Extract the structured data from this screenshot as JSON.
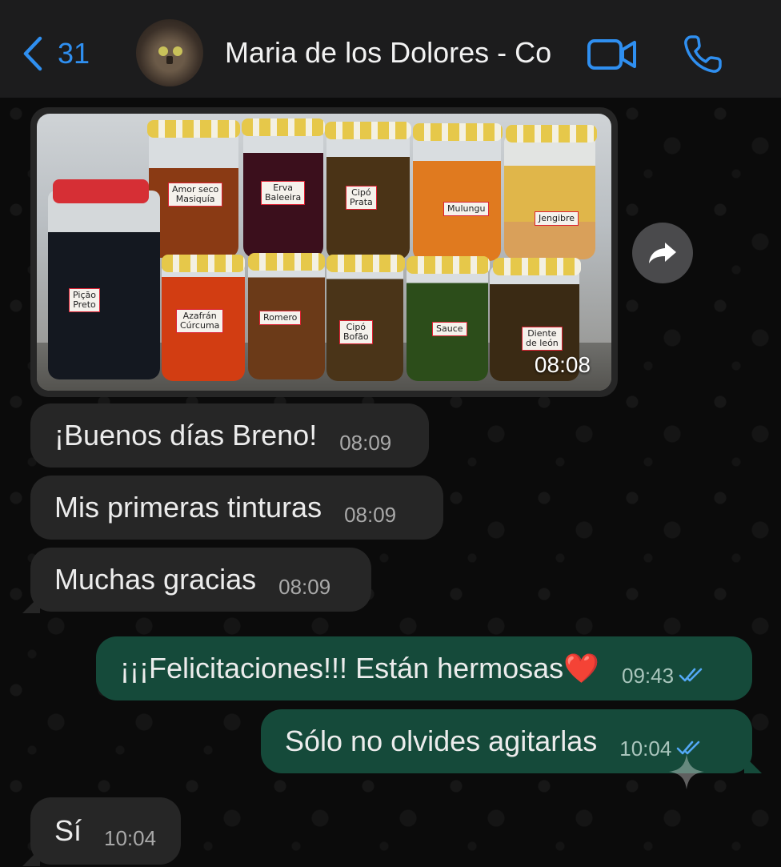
{
  "header": {
    "back_count": "31",
    "contact_name": "Maria de los Dolores - Co"
  },
  "image_message": {
    "time": "08:08",
    "jar_labels": [
      "Amor seco\nMasiquía",
      "Erva\nBaleeira",
      "Cipó\nPrata",
      "Mulungu",
      "Jengibre",
      "Pição\nPreto",
      "Azafrán\nCúrcuma",
      "Romero",
      "Cipó\nBofão",
      "Sauce",
      "Diente\nde león"
    ]
  },
  "messages": [
    {
      "direction": "in",
      "text": "¡Buenos días Breno!",
      "time": "08:09"
    },
    {
      "direction": "in",
      "text": "Mis primeras tinturas",
      "time": "08:09"
    },
    {
      "direction": "in",
      "text": "Muchas gracias",
      "time": "08:09"
    },
    {
      "direction": "out",
      "text": "¡¡¡Felicitaciones!!! Están hermosas❤️",
      "time": "09:43",
      "status": "read"
    },
    {
      "direction": "out",
      "text": "Sólo no olvides agitarlas",
      "time": "10:04",
      "status": "read"
    },
    {
      "direction": "in",
      "text": "Sí",
      "time": "10:04"
    }
  ],
  "icons": {
    "back": "chevron-left-icon",
    "video": "video-call-icon",
    "call": "phone-icon",
    "forward": "forward-icon",
    "read": "double-check-icon"
  },
  "colors": {
    "accent": "#2f8ff0",
    "incoming_bubble": "#262626",
    "outgoing_bubble": "#154a3a",
    "read_ticks": "#53a8f5"
  }
}
